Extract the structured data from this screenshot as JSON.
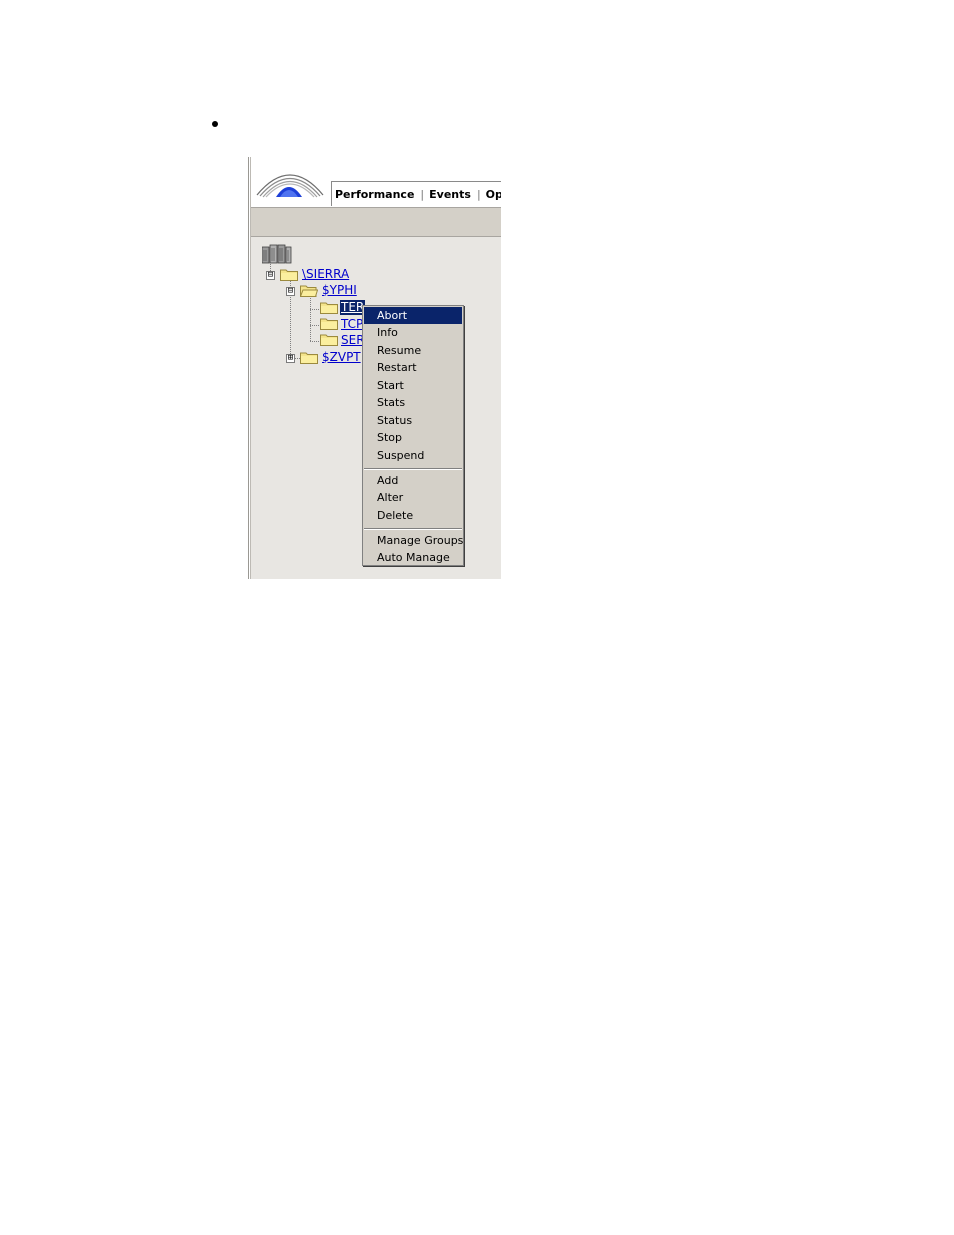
{
  "header": {
    "tabs": [
      {
        "label": "Performance"
      },
      {
        "label": "Events"
      },
      {
        "label": "Ope"
      }
    ],
    "tab_separator": "|"
  },
  "tree": {
    "root": {
      "icon": "server-rack-icon"
    },
    "nodes": [
      {
        "label": "\\SIERRA",
        "expander": "⊟"
      },
      {
        "label": "$YPHI",
        "expander": "⊟"
      },
      {
        "label": "TER",
        "selected": true
      },
      {
        "label": "TCP"
      },
      {
        "label": "SER"
      },
      {
        "label": "$ZVPT",
        "expander": "⊞"
      }
    ]
  },
  "context_menu": {
    "items": [
      {
        "label": "Abort"
      },
      {
        "label": "Info"
      },
      {
        "label": "Resume"
      },
      {
        "label": "Restart"
      },
      {
        "label": "Start"
      },
      {
        "label": "Stats"
      },
      {
        "label": "Status"
      },
      {
        "label": "Stop"
      },
      {
        "label": "Suspend"
      },
      {
        "label": "Add"
      },
      {
        "label": "Alter"
      },
      {
        "label": "Delete"
      },
      {
        "label": "Manage Groups"
      },
      {
        "label": "Auto Manage"
      }
    ],
    "highlighted": "Abort"
  },
  "colors": {
    "selection": "#0a246a",
    "link": "#0000cc",
    "menu_bg": "#d4d0c8"
  }
}
